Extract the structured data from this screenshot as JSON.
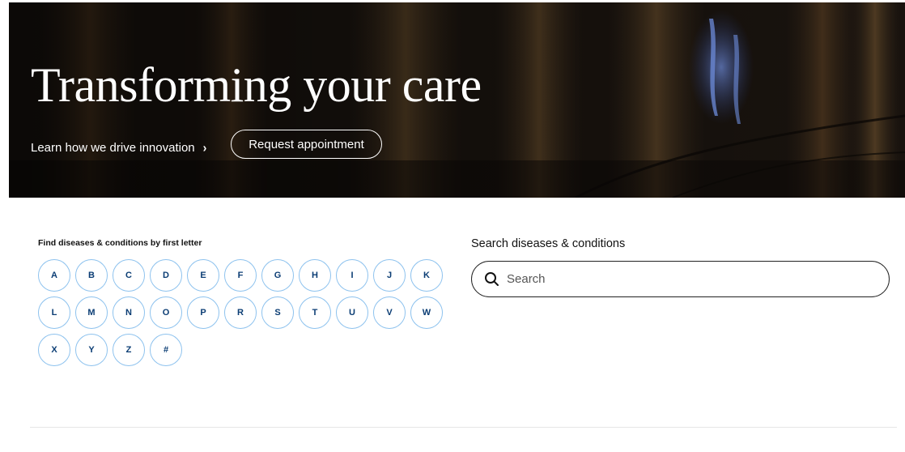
{
  "hero": {
    "title": "Transforming your care",
    "link_label": "Learn how we drive innovation",
    "link_chevron": "›",
    "button_label": "Request appointment"
  },
  "letters_section": {
    "heading": "Find diseases & conditions by first letter",
    "letters": [
      "A",
      "B",
      "C",
      "D",
      "E",
      "F",
      "G",
      "H",
      "I",
      "J",
      "K",
      "L",
      "M",
      "N",
      "O",
      "P",
      "R",
      "S",
      "T",
      "U",
      "V",
      "W",
      "X",
      "Y",
      "Z",
      "#"
    ]
  },
  "search_section": {
    "heading": "Search diseases & conditions",
    "placeholder": "Search",
    "icon": "search-icon"
  },
  "colors": {
    "letter_border": "#8dc2ee",
    "letter_text": "#0b3d74",
    "hero_text": "#ffffff"
  }
}
